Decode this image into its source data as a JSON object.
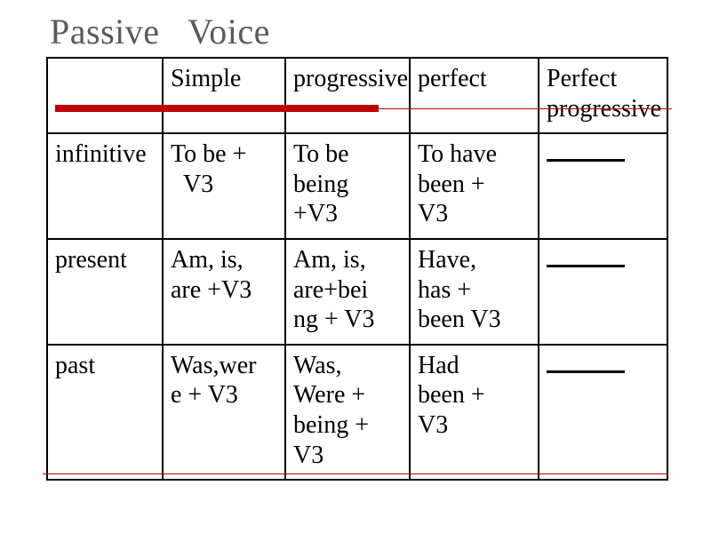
{
  "chart_data": {
    "type": "table",
    "title": "Passive Voice",
    "columns": [
      "",
      "Simple",
      "progressive",
      "perfect",
      "Perfect progressive"
    ],
    "rows": [
      {
        "label": "infinitive",
        "cells": [
          "To be + V3",
          "To be being +V3",
          "To have been + V3",
          ""
        ]
      },
      {
        "label": "present",
        "cells": [
          "Am, is, are +V3",
          "Am, is, are+being + V3",
          "Have, has + been V3",
          ""
        ]
      },
      {
        "label": "past",
        "cells": [
          "Was,were + V3",
          "Was, Were + being + V3",
          "Had been + V3",
          ""
        ]
      }
    ]
  },
  "title": "Passive   Voice",
  "headers": {
    "simple": "Simple",
    "progressive": "progressive",
    "perfect": "perfect",
    "perfprog_l1": "Perfect",
    "perfprog_l2": "progressive"
  },
  "rowlabels": {
    "infinitive": "infinitive",
    "present": "present",
    "past": "past"
  },
  "cells": {
    "inf_simple_l1": "To be +",
    "inf_simple_l2": "  V3",
    "inf_prog_l1": "To be",
    "inf_prog_l2": "being",
    "inf_prog_l3": "+V3",
    "inf_perf_l1": "To have",
    "inf_perf_l2": "been +",
    "inf_perf_l3": "V3",
    "pres_simple_l1": "Am, is,",
    "pres_simple_l2": "are +V3",
    "pres_prog_l1": "Am, is,",
    "pres_prog_l2": "are+bei",
    "pres_prog_l3": "ng + V3",
    "pres_perf_l1": "Have,",
    "pres_perf_l2": "has +",
    "pres_perf_l3": "been V3",
    "past_simple_l1": "Was,wer",
    "past_simple_l2": "e + V3",
    "past_prog_l1": "Was,",
    "past_prog_l2": "Were +",
    "past_prog_l3": "being +",
    "past_prog_l4": "V3",
    "past_perf_l1": "Had",
    "past_perf_l2": "been +",
    "past_perf_l3": "V3"
  }
}
